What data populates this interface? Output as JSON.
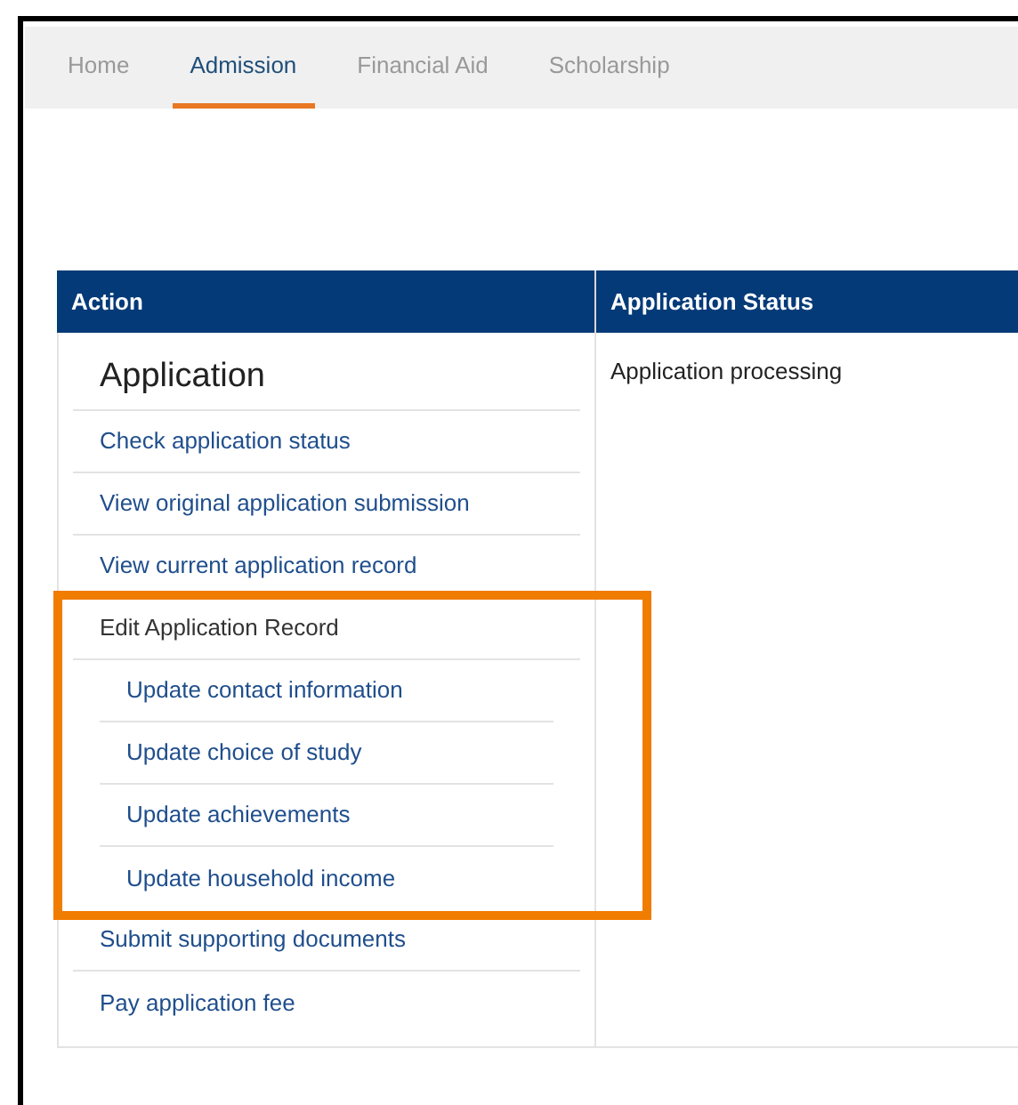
{
  "tabs": [
    {
      "label": "Home",
      "selected": false
    },
    {
      "label": "Admission",
      "selected": true
    },
    {
      "label": "Financial Aid",
      "selected": false
    },
    {
      "label": "Scholarship",
      "selected": false
    }
  ],
  "table": {
    "columns": [
      "Action",
      "Application Status"
    ],
    "action_title": "Application",
    "actions": [
      {
        "kind": "link",
        "label": "Check application status"
      },
      {
        "kind": "link",
        "label": "View original application submission"
      },
      {
        "kind": "link",
        "label": "View current application record"
      },
      {
        "kind": "group",
        "label": "Edit Application Record",
        "highlighted": true,
        "children": [
          {
            "kind": "link",
            "label": "Update contact information"
          },
          {
            "kind": "link",
            "label": "Update choice of study"
          },
          {
            "kind": "link",
            "label": "Update achievements"
          },
          {
            "kind": "link",
            "label": "Update household income"
          }
        ]
      },
      {
        "kind": "link",
        "label": "Submit supporting documents"
      },
      {
        "kind": "link",
        "label": "Pay application fee"
      }
    ],
    "status": "Application processing"
  }
}
